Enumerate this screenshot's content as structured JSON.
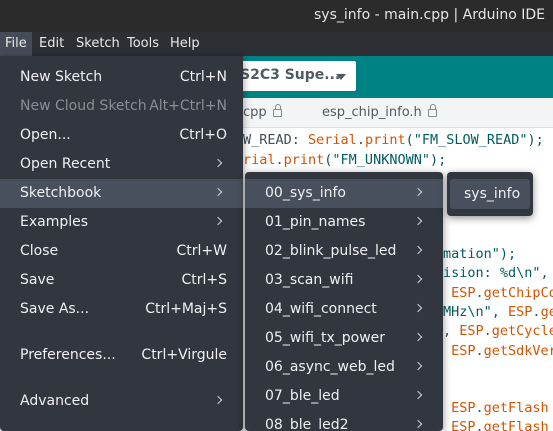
{
  "window": {
    "title": "sys_info - main.cpp | Arduino IDE"
  },
  "menubar": {
    "items": [
      "File",
      "Edit",
      "Sketch",
      "Tools",
      "Help"
    ],
    "active": "File"
  },
  "toolbar": {
    "board": "S2C3 Supe..."
  },
  "tabs": [
    "cpp",
    "esp_chip_info.h"
  ],
  "code": {
    "l1_a": "W_READ: ",
    "l1_b": "Serial",
    "l1_c": ".",
    "l1_d": "print",
    "l1_e": "(\"FM_SLOW_READ\");",
    "l2_a": "rial",
    "l2_b": ".",
    "l2_c": "print",
    "l2_d": "(\"FM_UNKNOWN\");",
    "l3": "mation\");",
    "l4": "ision: %d\\n\",",
    "l5_a": " ESP",
    "l5_b": ".",
    "l5_c": "getChipCo",
    "l6_a": "MHz\\n\", ",
    "l6_b": "ESP",
    "l6_c": ".",
    "l6_d": "ge",
    "l7_a": ", ",
    "l7_b": "ESP",
    "l7_c": ".",
    "l7_d": "getCycle",
    "l8_a": " ESP",
    "l8_b": ".",
    "l8_c": "getSdkVer",
    "l9_a": " ESP",
    "l9_b": ".",
    "l9_c": "getFlash",
    "l10_a": " ESP",
    "l10_b": ".",
    "l10_c": "getFlash"
  },
  "file_menu": {
    "items": [
      {
        "label": "New Sketch",
        "shortcut": "Ctrl+N"
      },
      {
        "label": "New Cloud Sketch",
        "shortcut": "Alt+Ctrl+N",
        "disabled": true
      },
      {
        "label": "Open...",
        "shortcut": "Ctrl+O"
      },
      {
        "label": "Open Recent",
        "submenu": true
      },
      {
        "label": "Sketchbook",
        "submenu": true,
        "highlighted": true
      },
      {
        "label": "Examples",
        "submenu": true
      },
      {
        "label": "Close",
        "shortcut": "Ctrl+W"
      },
      {
        "label": "Save",
        "shortcut": "Ctrl+S"
      },
      {
        "label": "Save As...",
        "shortcut": "Ctrl+Maj+S"
      },
      {
        "label": "Preferences...",
        "shortcut": "Ctrl+Virgule"
      },
      {
        "label": "Advanced",
        "submenu": true
      }
    ]
  },
  "sketchbook_menu": {
    "items": [
      "00_sys_info",
      "01_pin_names",
      "02_blink_pulse_led",
      "03_scan_wifi",
      "04_wifi_connect",
      "05_wifi_tx_power",
      "06_async_web_led",
      "07_ble_led",
      "08_ble_led2"
    ],
    "highlighted": "00_sys_info"
  },
  "sysinfo_menu": {
    "items": [
      "sys_info"
    ]
  },
  "colors": {
    "menu_bg": "#31363f",
    "highlight": "#47505c",
    "toolbar": "#008184",
    "keyword": "#d35400",
    "string": "#005c5f"
  }
}
